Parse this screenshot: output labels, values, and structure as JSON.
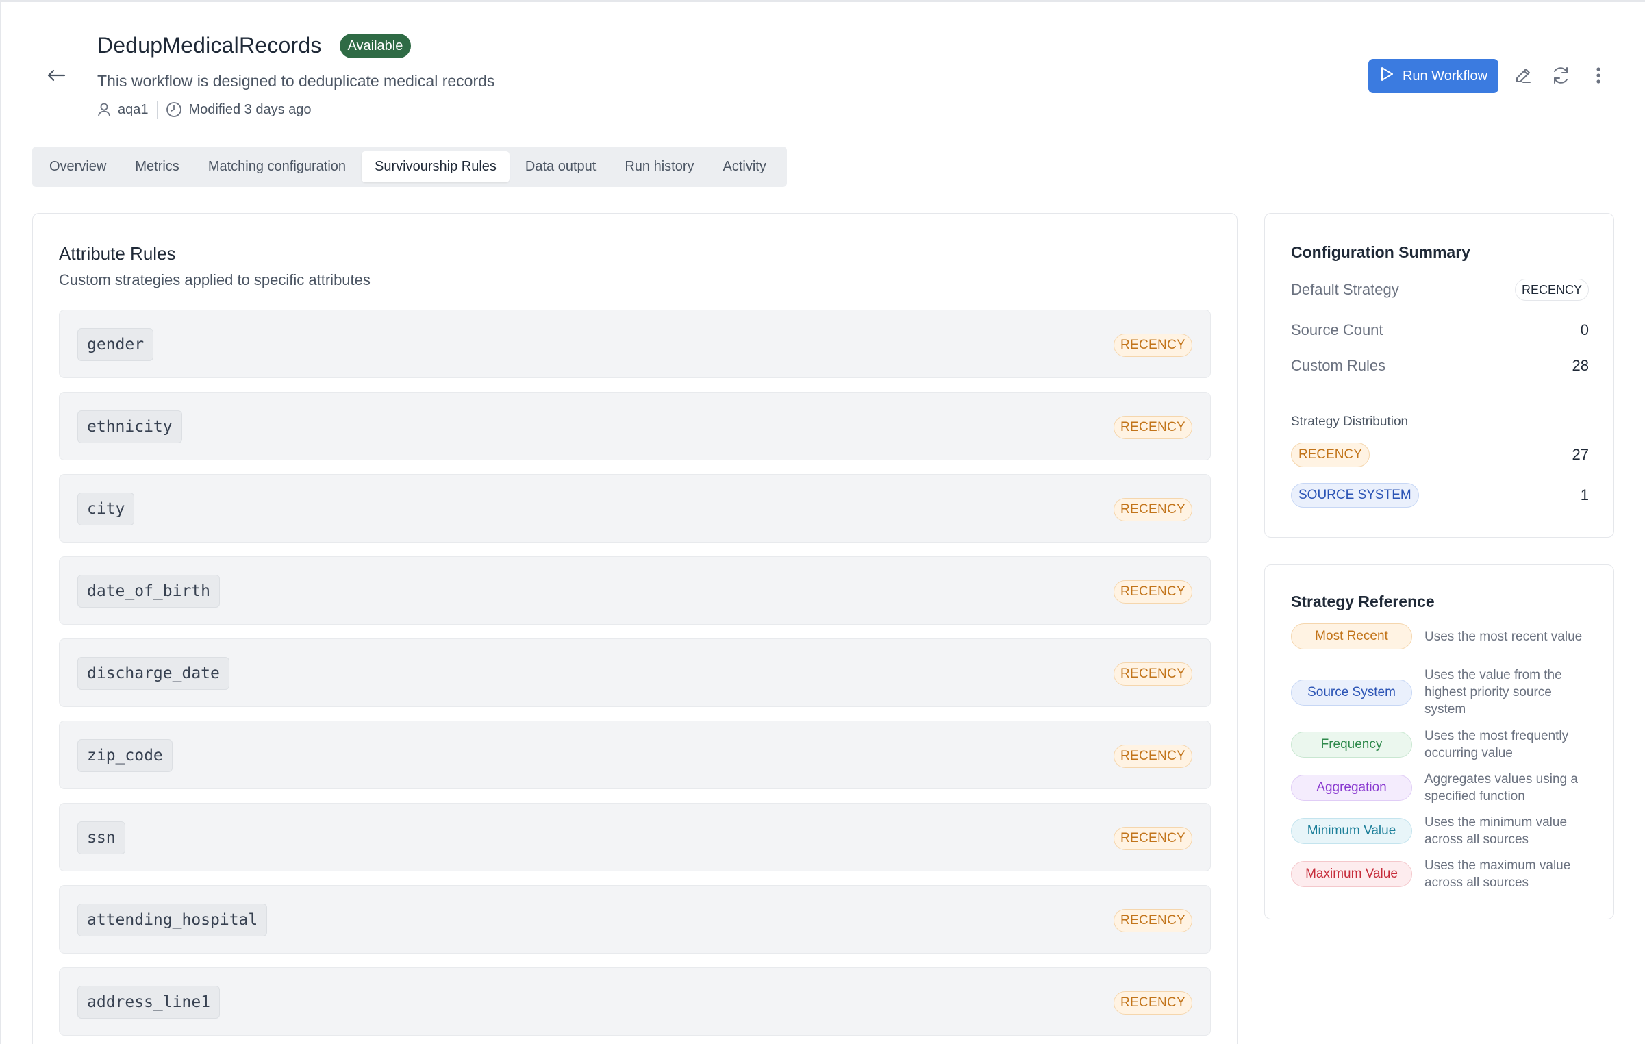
{
  "header": {
    "title": "DedupMedicalRecords",
    "status": "Available",
    "description": "This workflow is designed to deduplicate medical records",
    "owner": "aqa1",
    "modified": "Modified 3 days ago",
    "run_label": "Run Workflow"
  },
  "tabs": [
    {
      "label": "Overview"
    },
    {
      "label": "Metrics"
    },
    {
      "label": "Matching configuration"
    },
    {
      "label": "Survivourship Rules",
      "active": true
    },
    {
      "label": "Data output"
    },
    {
      "label": "Run history"
    },
    {
      "label": "Activity"
    }
  ],
  "attribute_rules": {
    "title": "Attribute Rules",
    "subtitle": "Custom strategies applied to specific attributes",
    "rules": [
      {
        "attribute": "gender",
        "strategy": "RECENCY"
      },
      {
        "attribute": "ethnicity",
        "strategy": "RECENCY"
      },
      {
        "attribute": "city",
        "strategy": "RECENCY"
      },
      {
        "attribute": "date_of_birth",
        "strategy": "RECENCY"
      },
      {
        "attribute": "discharge_date",
        "strategy": "RECENCY"
      },
      {
        "attribute": "zip_code",
        "strategy": "RECENCY"
      },
      {
        "attribute": "ssn",
        "strategy": "RECENCY"
      },
      {
        "attribute": "attending_hospital",
        "strategy": "RECENCY"
      },
      {
        "attribute": "address_line1",
        "strategy": "RECENCY"
      }
    ]
  },
  "summary": {
    "title": "Configuration Summary",
    "default_strategy_label": "Default Strategy",
    "default_strategy": "RECENCY",
    "source_count_label": "Source Count",
    "source_count": "0",
    "custom_rules_label": "Custom Rules",
    "custom_rules": "28",
    "distribution_label": "Strategy Distribution",
    "distribution": [
      {
        "strategy": "RECENCY",
        "count": "27"
      },
      {
        "strategy": "SOURCE SYSTEM",
        "count": "1"
      }
    ]
  },
  "reference": {
    "title": "Strategy Reference",
    "items": [
      {
        "name": "Most Recent",
        "desc": "Uses the most recent value"
      },
      {
        "name": "Source System",
        "desc": "Uses the value from the highest priority source system"
      },
      {
        "name": "Frequency",
        "desc": "Uses the most frequently occurring value"
      },
      {
        "name": "Aggregation",
        "desc": "Aggregates values using a specified function"
      },
      {
        "name": "Minimum Value",
        "desc": "Uses the minimum value across all sources"
      },
      {
        "name": "Maximum Value",
        "desc": "Uses the maximum value across all sources"
      }
    ]
  },
  "icons": {
    "back": "arrow-left-icon",
    "user": "user-icon",
    "clock": "clock-icon",
    "play": "play-icon",
    "edit": "pencil-icon",
    "refresh": "refresh-icon",
    "more": "more-vertical-icon"
  },
  "colors": {
    "primary": "#3b7be0",
    "status_available": "#2f6b45",
    "recency": "#c2741a",
    "source_system": "#2b54b5"
  }
}
